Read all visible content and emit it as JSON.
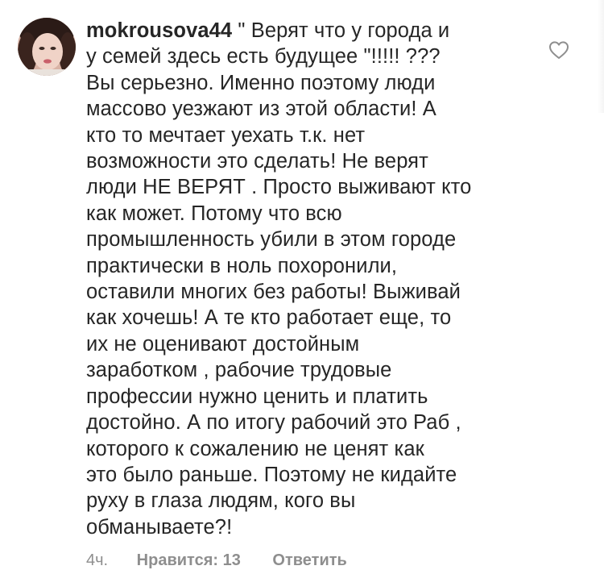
{
  "comment": {
    "username": "mokrousova44",
    "text_lines": [
      "\" Верят что у города и",
      "у семей здесь есть будущее \"!!!!! ???",
      "Вы серьезно. Именно поэтому люди",
      "массово уезжают из этой области! А",
      "кто то мечтает уехать т.к. нет",
      "возможности это сделать! Не верят",
      "люди НЕ ВЕРЯТ . Просто выживают кто",
      "как может. Потому что всю",
      "промышленность убили в этом городе",
      "практически в ноль похоронили,",
      "оставили многих без работы! Выживай",
      "как хочешь! А те кто работает еще, то",
      "их не оценивают достойным",
      "заработком , рабочие трудовые",
      "профессии нужно ценить и платить",
      "достойно. А по итогу рабочий это Раб ,",
      "которого к сожалению не ценят как",
      "это было раньше. Поэтому не кидайте",
      "руху в глаза людям, кого вы",
      "обманываете?!"
    ],
    "time": "4ч.",
    "likes_label": "Нравится: 13",
    "reply_label": "Ответить"
  },
  "icons": {
    "like": "heart-outline-icon",
    "avatar": "user-avatar"
  },
  "colors": {
    "text": "#262626",
    "secondary": "#8e8e8e",
    "background": "#ffffff"
  }
}
